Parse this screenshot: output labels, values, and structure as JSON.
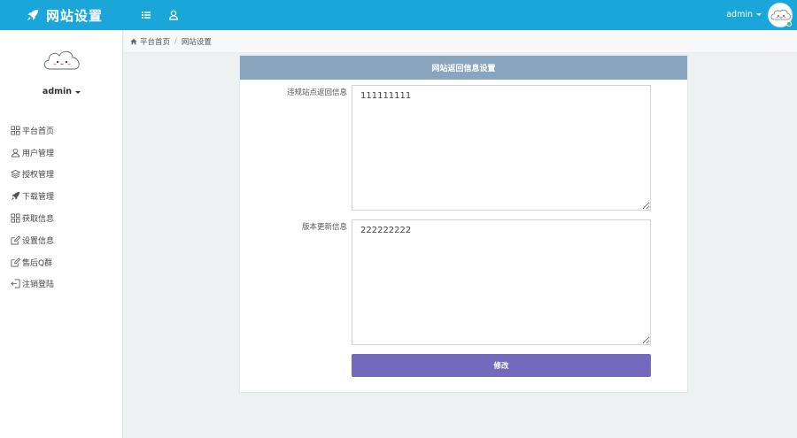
{
  "app": {
    "title": "网站设置"
  },
  "header": {
    "username": "admin"
  },
  "sidebar": {
    "username": "admin",
    "items": [
      {
        "label": "平台首页",
        "icon": "grid-icon"
      },
      {
        "label": "用户管理",
        "icon": "user-icon"
      },
      {
        "label": "授权管理",
        "icon": "layers-icon"
      },
      {
        "label": "下载管理",
        "icon": "rocket-icon"
      },
      {
        "label": "获取信息",
        "icon": "grid-icon"
      },
      {
        "label": "设置信息",
        "icon": "edit-icon"
      },
      {
        "label": "售后Q群",
        "icon": "edit-icon"
      },
      {
        "label": "注销登陆",
        "icon": "logout-icon"
      }
    ]
  },
  "breadcrumb": {
    "home": "平台首页",
    "current": "网站设置"
  },
  "panel": {
    "title": "网站返回信息设置",
    "fields": [
      {
        "label": "违规站点返回信息",
        "value": "111111111"
      },
      {
        "label": "版本更新信息",
        "value": "222222222"
      }
    ],
    "submit_label": "修改"
  },
  "colors": {
    "topbar": "#1aa6d8",
    "panel_header": "#87a5be",
    "submit_button": "#7469bd",
    "online": "#33c36a"
  }
}
